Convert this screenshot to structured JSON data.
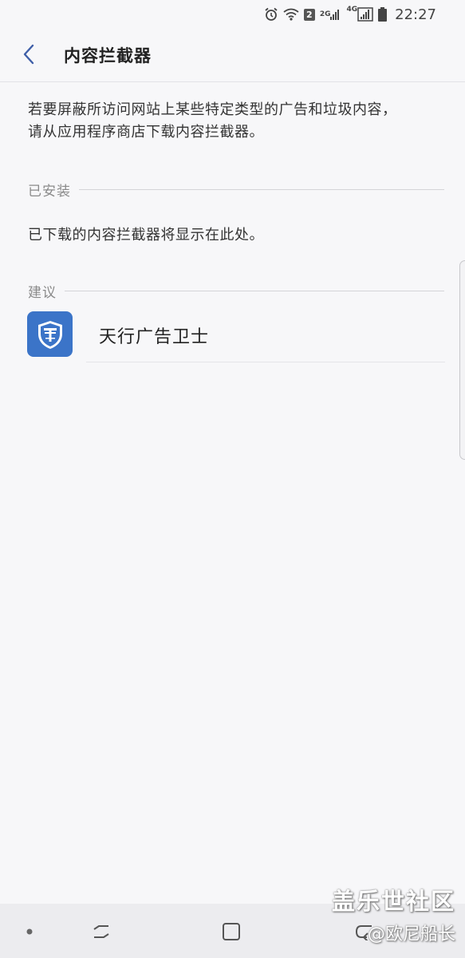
{
  "status_bar": {
    "time": "22:27",
    "sim_badge": "2",
    "network_2g": "2G",
    "network_4g": "4G",
    "icons": [
      "alarm-icon",
      "wifi-icon",
      "sim2-icon",
      "signal-2g-icon",
      "signal-4g-icon",
      "battery-icon"
    ]
  },
  "app_bar": {
    "title": "内容拦截器",
    "back_icon": "chevron-left-icon"
  },
  "description": {
    "line1": "若要屏蔽所访问网站上某些特定类型的广告和垃圾内容，",
    "line2": "请从应用程序商店下载内容拦截器。"
  },
  "installed": {
    "header": "已安装",
    "empty_text": "已下载的内容拦截器将显示在此处。"
  },
  "suggestions": {
    "header": "建议",
    "items": [
      {
        "name": "天行广告卫士",
        "icon": "shield-app-icon",
        "icon_color": "#3b74c8"
      }
    ]
  },
  "watermark": {
    "line1": "盖乐世社区",
    "line2": "@欧尼船长"
  },
  "nav_bar": {
    "buttons": [
      "recents-icon",
      "home-icon",
      "back-icon"
    ]
  },
  "colors": {
    "background": "#f7f7f9",
    "accent": "#3f5fa8",
    "divider": "#d4d4d8"
  }
}
